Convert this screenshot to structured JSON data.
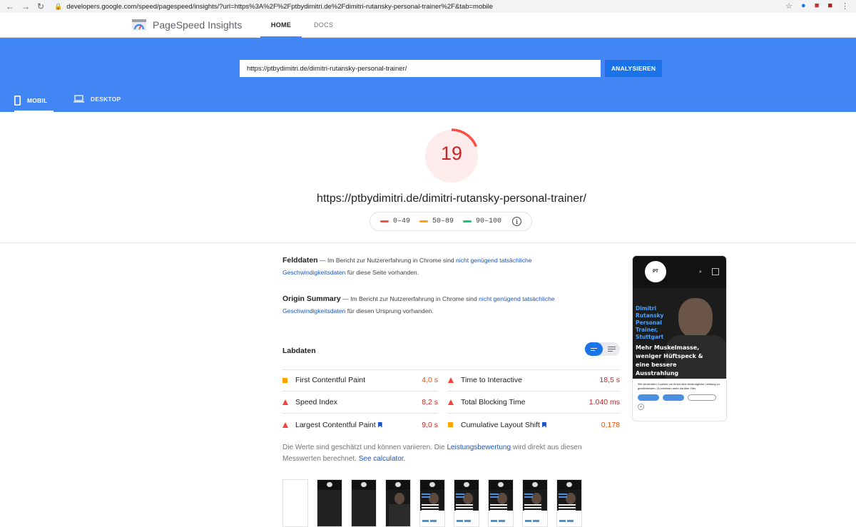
{
  "browser": {
    "url": "developers.google.com/speed/pagespeed/insights/?url=https%3A%2F%2Fptbydimitri.de%2Fdimitri-rutansky-personal-trainer%2F&tab=mobile",
    "back_glyph": "←",
    "forward_glyph": "→",
    "reload_glyph": "↻",
    "lock_glyph": "🔒",
    "star_glyph": "☆",
    "menu_glyph": "⋮"
  },
  "header": {
    "app_title": "PageSpeed Insights",
    "tabs": [
      {
        "label": "HOME",
        "active": true
      },
      {
        "label": "DOCS",
        "active": false
      }
    ]
  },
  "analyze": {
    "url_value": "https://ptbydimitri.de/dimitri-rutansky-personal-trainer/",
    "button_label": "ANALYSIEREN"
  },
  "device_tabs": [
    {
      "label": "MOBIL",
      "icon": "smartphone-icon",
      "active": true
    },
    {
      "label": "DESKTOP",
      "icon": "laptop-icon",
      "active": false
    }
  ],
  "result": {
    "score": "19",
    "score_fraction": 0.19,
    "score_color": "#c62828",
    "tested_url": "https://ptbydimitri.de/dimitri-rutansky-personal-trainer/",
    "legend": [
      {
        "label": "0–49",
        "color": "#ff4e42"
      },
      {
        "label": "50–89",
        "color": "#ffa400"
      },
      {
        "label": "90–100",
        "color": "#0cce6b"
      }
    ]
  },
  "field_data": {
    "title": "Felddaten",
    "text_before": " — Im Bericht zur Nutzererfahrung in Chrome sind ",
    "link": "nicht genügend tatsächliche Geschwindigkeitsdaten",
    "text_after": " für diese Seite vorhanden."
  },
  "origin_summary": {
    "title": "Origin Summary",
    "text_before": " — Im Bericht zur Nutzererfahrung in Chrome sind ",
    "link": "nicht genügend tatsächliche Geschwindigkeitsdaten",
    "text_after": " für diesen Ursprung vorhanden."
  },
  "lab_data": {
    "title": "Labdaten",
    "metrics": [
      {
        "label": "First Contentful Paint",
        "value": "4,0 s",
        "status": "average"
      },
      {
        "label": "Time to Interactive",
        "value": "18,5 s",
        "status": "fail"
      },
      {
        "label": "Speed Index",
        "value": "8,2 s",
        "status": "fail"
      },
      {
        "label": "Total Blocking Time",
        "value": "1.040 ms",
        "status": "fail"
      },
      {
        "label": "Largest Contentful Paint",
        "value": "9,0 s",
        "status": "fail",
        "bookmark": true
      },
      {
        "label": "Cumulative Layout Shift",
        "value": "0,178",
        "status": "average",
        "bookmark": true
      }
    ],
    "note_before": "Die Werte sind geschätzt und können variieren. Die ",
    "note_link": "Leistungsbewertung",
    "note_middle": " wird direkt aus diesen Messwerten berechnet. ",
    "note_link2": "See calculator."
  },
  "preview": {
    "logo": "PT",
    "name_line": "Dimitri Rutansky Personal Trainer, Stuttgart",
    "headline": "Mehr Muskelmasse, weniger Hüftspeck & eine bessere Ausstrahlung",
    "cookie_text": "Wir verwenden Cookies um Ihnen eine bestmögliche Leistung zu gewährleisten. Zu erfahren mehr darüber Hier."
  }
}
